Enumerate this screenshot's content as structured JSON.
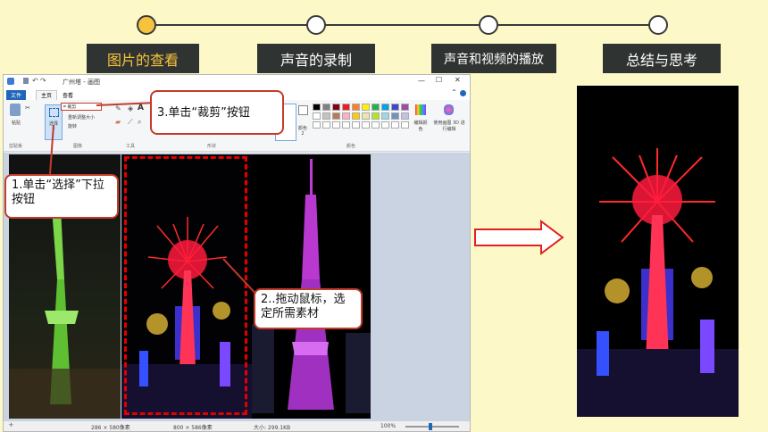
{
  "nav": {
    "steps": [
      {
        "label": "图片的查看",
        "active": true
      },
      {
        "label": "声音的录制",
        "active": false
      },
      {
        "label": "声音和视频的播放",
        "active": false
      },
      {
        "label": "总结与思考",
        "active": false
      }
    ]
  },
  "paint": {
    "title": "广州塔 - 画图",
    "menu": {
      "file": "文件",
      "home": "主页",
      "view": "查看"
    },
    "ribbon": {
      "clipboard_label": "剪贴板",
      "paste": "粘贴",
      "image_label": "图像",
      "select": "选择",
      "crop": "裁剪",
      "resize": "重新调整大小",
      "rotate": "旋转",
      "tools_label": "工具",
      "shapes_label": "形状",
      "color2": "颜色 2",
      "colors_label": "颜色",
      "edit_colors": "编辑颜色",
      "paint3d": "使用画图 3D 进行编辑"
    },
    "status": {
      "selection": "286 × 580像素",
      "canvas": "800 × 586像素",
      "size": "大小: 299.1KB",
      "zoom": "100%"
    }
  },
  "callouts": {
    "step1": "1.单击“选择”下拉按钮",
    "step2": "2..拖动鼠标，选定所需素材",
    "step3": "3.单击“裁剪”按钮"
  },
  "colors": {
    "accent": "#f7c33d",
    "callout_border": "#c23b2b",
    "background": "#fcf8c8"
  }
}
